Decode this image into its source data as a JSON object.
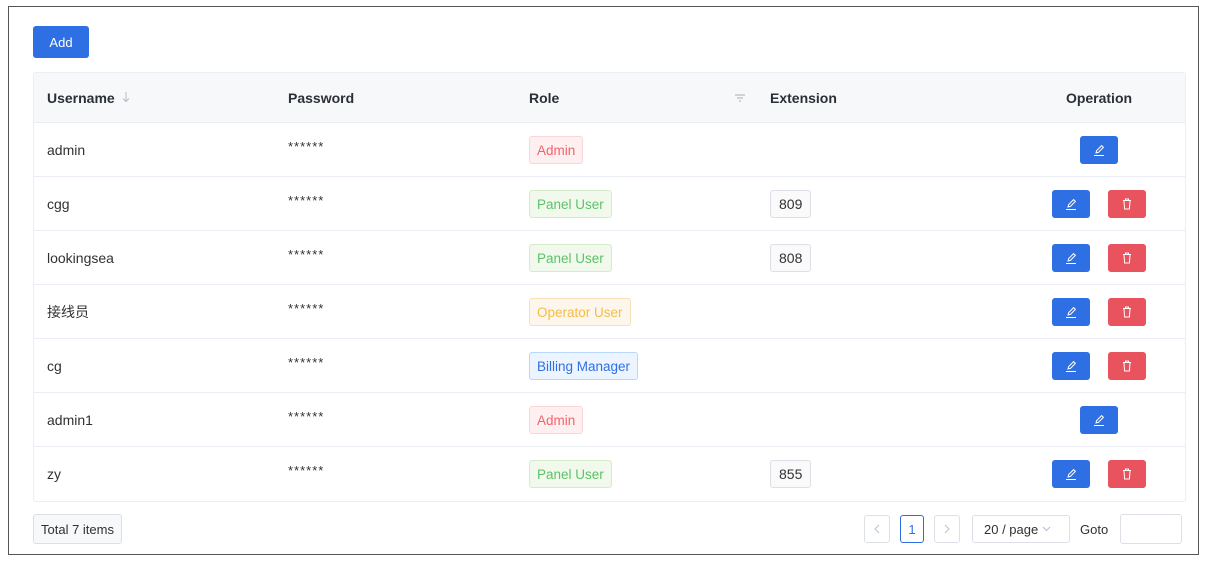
{
  "toolbar": {
    "add_label": "Add"
  },
  "table": {
    "columns": {
      "username": "Username",
      "password": "Password",
      "role": "Role",
      "extension": "Extension",
      "operation": "Operation"
    },
    "rows": [
      {
        "username": "admin",
        "password": "******",
        "role": "Admin",
        "role_type": "admin",
        "extension": "",
        "deletable": false
      },
      {
        "username": "cgg",
        "password": "******",
        "role": "Panel User",
        "role_type": "panel",
        "extension": "809",
        "deletable": true
      },
      {
        "username": "lookingsea",
        "password": "******",
        "role": "Panel User",
        "role_type": "panel",
        "extension": "808",
        "deletable": true
      },
      {
        "username": "接线员",
        "password": "******",
        "role": "Operator User",
        "role_type": "operator",
        "extension": "",
        "deletable": true
      },
      {
        "username": "cg",
        "password": "******",
        "role": "Billing Manager",
        "role_type": "billing",
        "extension": "",
        "deletable": true
      },
      {
        "username": "admin1",
        "password": "******",
        "role": "Admin",
        "role_type": "admin",
        "extension": "",
        "deletable": false
      },
      {
        "username": "zy",
        "password": "******",
        "role": "Panel User",
        "role_type": "panel",
        "extension": "855",
        "deletable": true
      }
    ]
  },
  "pagination": {
    "total_label": "Total 7 items",
    "current_page": "1",
    "page_size_label": "20 / page",
    "goto_label": "Goto"
  },
  "icons": {
    "sort": "arrow-down-icon",
    "filter": "filter-icon",
    "edit": "edit-icon",
    "delete": "trash-icon"
  },
  "colors": {
    "primary": "#2f6fe4",
    "danger": "#e9535d"
  }
}
